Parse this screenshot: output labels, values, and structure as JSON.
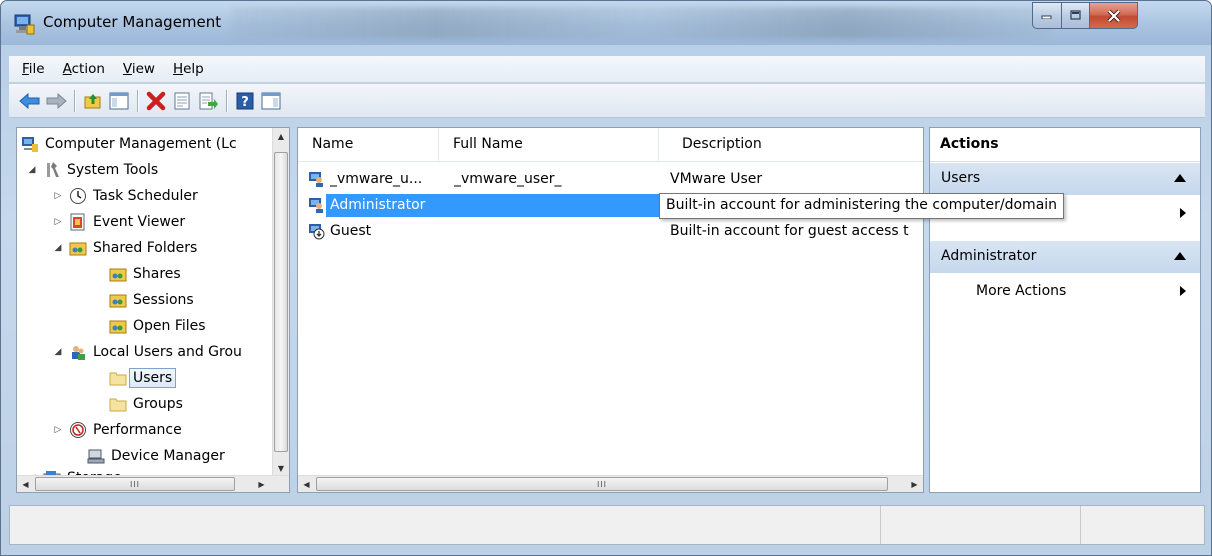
{
  "window": {
    "title": "Computer Management"
  },
  "menu": [
    {
      "label": "File",
      "underline": "F",
      "rest": "ile"
    },
    {
      "label": "Action",
      "underline": "A",
      "rest": "ction"
    },
    {
      "label": "View",
      "underline": "V",
      "rest": "iew"
    },
    {
      "label": "Help",
      "underline": "H",
      "rest": "elp"
    }
  ],
  "tree": {
    "root": "Computer Management (Lc",
    "system_tools": "System Tools",
    "task_scheduler": "Task Scheduler",
    "event_viewer": "Event Viewer",
    "shared_folders": "Shared Folders",
    "shares": "Shares",
    "sessions": "Sessions",
    "open_files": "Open Files",
    "local_users": "Local Users and Grou",
    "users": "Users",
    "groups": "Groups",
    "performance": "Performance",
    "device_manager": "Device Manager",
    "storage": "Storage",
    "hscroll_grip": "III"
  },
  "list": {
    "columns": {
      "name": "Name",
      "full_name": "Full Name",
      "description": "Description"
    },
    "rows": [
      {
        "name": "_vmware_u...",
        "full_name": "_vmware_user_",
        "description": "VMware User"
      },
      {
        "name": "Administrator",
        "full_name": "",
        "description": ""
      },
      {
        "name": "Guest",
        "full_name": "",
        "description": "Built-in account for guest access t"
      }
    ],
    "tooltip": "Built-in account for administering the computer/domain",
    "hscroll_grip": "III"
  },
  "actions": {
    "title": "Actions",
    "section_users": "Users",
    "section_admin": "Administrator",
    "more_actions": "More Actions"
  },
  "colors": {
    "selection": "#3399ff",
    "actions_header": "#c6d8ed",
    "close_button": "#c04a32"
  }
}
